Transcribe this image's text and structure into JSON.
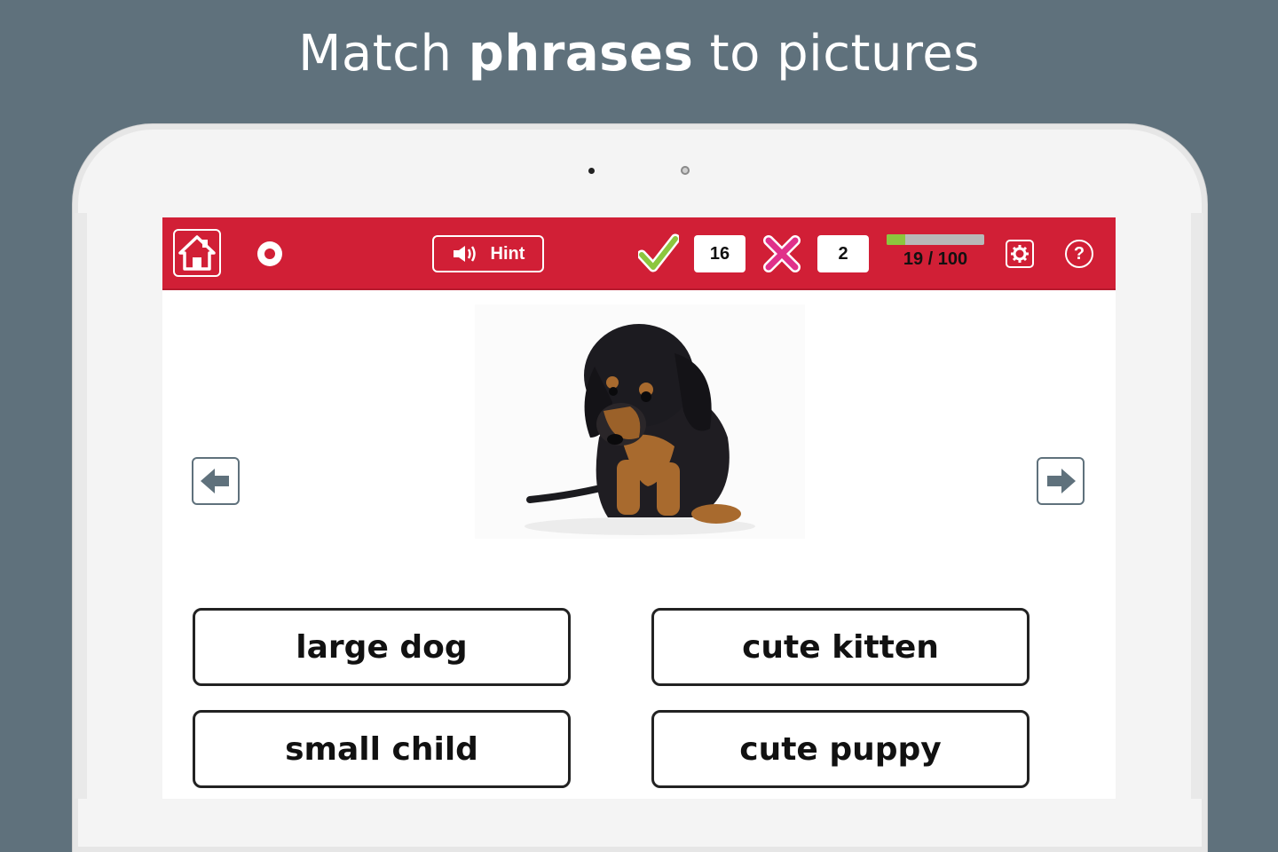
{
  "headline": {
    "prefix": "Match",
    "bold": "phrases",
    "suffix": "to pictures"
  },
  "toolbar": {
    "hint_label": "Hint",
    "correct_count": "16",
    "wrong_count": "2",
    "progress_text": "19 / 100",
    "progress_fraction": 0.19,
    "help_label": "?"
  },
  "answers": [
    "large dog",
    "cute kitten",
    "small child",
    "cute puppy"
  ],
  "icons": {
    "home": "home-icon",
    "record": "record-icon",
    "speaker": "speaker-icon",
    "correct": "checkmark-icon",
    "wrong": "cross-icon",
    "settings": "gear-icon",
    "help": "help-icon",
    "prev": "arrow-left-icon",
    "next": "arrow-right-icon"
  },
  "colors": {
    "background": "#5f717c",
    "toolbar": "#d11f36",
    "check": "#8cc63e",
    "cross": "#e0308a",
    "progress_fill": "#8cc63e"
  }
}
